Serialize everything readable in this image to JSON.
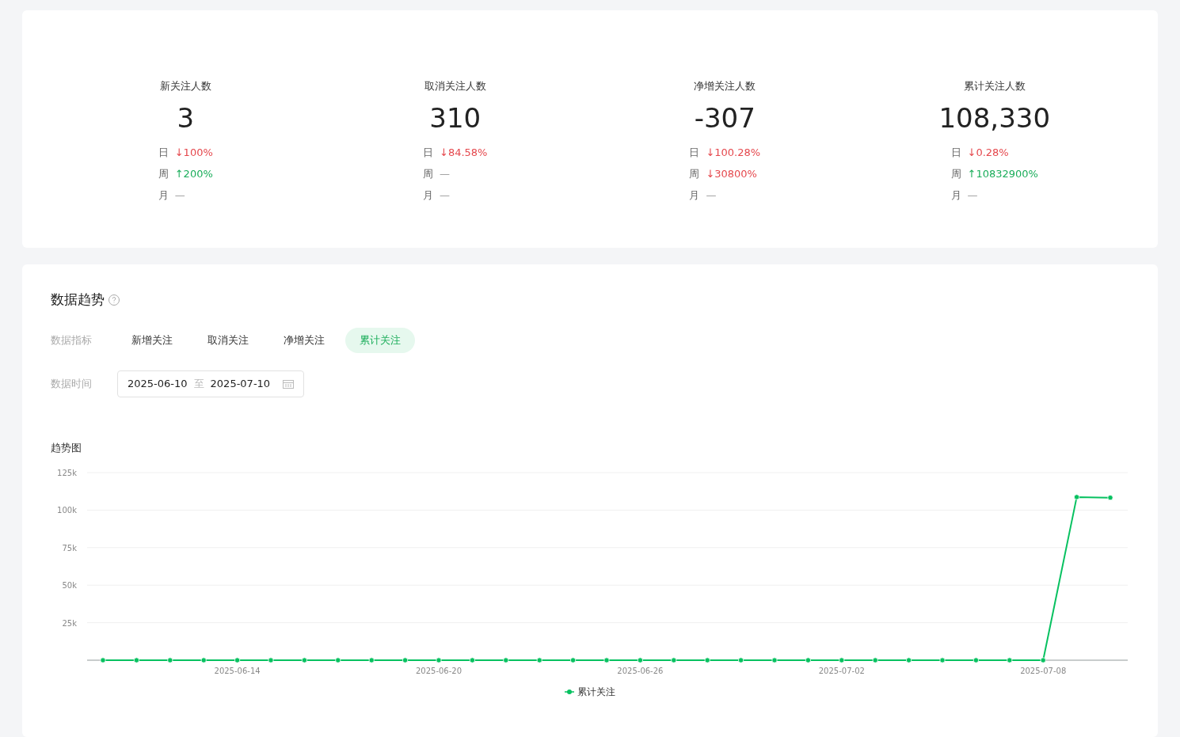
{
  "stats": [
    {
      "title": "新关注人数",
      "value": "3",
      "deltas": [
        {
          "period": "日",
          "value": "↓100%",
          "color": "#e5484d"
        },
        {
          "period": "周",
          "value": "↑200%",
          "color": "#1aad5a"
        },
        {
          "period": "月",
          "value": "—",
          "color": "#999999"
        }
      ]
    },
    {
      "title": "取消关注人数",
      "value": "310",
      "deltas": [
        {
          "period": "日",
          "value": "↓84.58%",
          "color": "#e5484d"
        },
        {
          "period": "周",
          "value": "—",
          "color": "#999999"
        },
        {
          "period": "月",
          "value": "—",
          "color": "#999999"
        }
      ]
    },
    {
      "title": "净增关注人数",
      "value": "-307",
      "deltas": [
        {
          "period": "日",
          "value": "↓100.28%",
          "color": "#e5484d"
        },
        {
          "period": "周",
          "value": "↓30800%",
          "color": "#e5484d"
        },
        {
          "period": "月",
          "value": "—",
          "color": "#999999"
        }
      ]
    },
    {
      "title": "累计关注人数",
      "value": "108,330",
      "deltas": [
        {
          "period": "日",
          "value": "↓0.28%",
          "color": "#e5484d"
        },
        {
          "period": "周",
          "value": "↑10832900%",
          "color": "#1aad5a"
        },
        {
          "period": "月",
          "value": "—",
          "color": "#999999"
        }
      ]
    }
  ],
  "trend": {
    "title": "数据趋势",
    "metric_label": "数据指标",
    "metrics": [
      {
        "label": "新增关注",
        "selected": false
      },
      {
        "label": "取消关注",
        "selected": false
      },
      {
        "label": "净增关注",
        "selected": false
      },
      {
        "label": "累计关注",
        "selected": true
      }
    ],
    "time_label": "数据时间",
    "date_range": {
      "start": "2025-06-10",
      "separator": "至",
      "end": "2025-07-10"
    },
    "chart_title": "趋势图",
    "chart_data": {
      "type": "line",
      "grid": true,
      "categories": [
        null,
        null,
        null,
        null,
        "2025-06-14",
        null,
        null,
        null,
        null,
        null,
        "2025-06-20",
        null,
        null,
        null,
        null,
        null,
        "2025-06-26",
        null,
        null,
        null,
        null,
        null,
        "2025-07-02",
        null,
        null,
        null,
        null,
        null,
        "2025-07-08",
        null,
        null
      ],
      "ylim": [
        0,
        125000
      ],
      "yticks": [
        {
          "value": 25000,
          "label": "25k"
        },
        {
          "value": 50000,
          "label": "50k"
        },
        {
          "value": 75000,
          "label": "75k"
        },
        {
          "value": 100000,
          "label": "100k"
        },
        {
          "value": 125000,
          "label": "125k"
        }
      ],
      "series": [
        {
          "name": "累计关注",
          "color": "#07c160",
          "marker": "circle",
          "values": [
            0,
            0,
            0,
            0,
            0,
            0,
            0,
            0,
            0,
            0,
            0,
            0,
            0,
            0,
            0,
            0,
            0,
            0,
            0,
            0,
            0,
            0,
            0,
            0,
            0,
            0,
            0,
            0,
            0,
            108700,
            108300
          ]
        }
      ]
    }
  }
}
